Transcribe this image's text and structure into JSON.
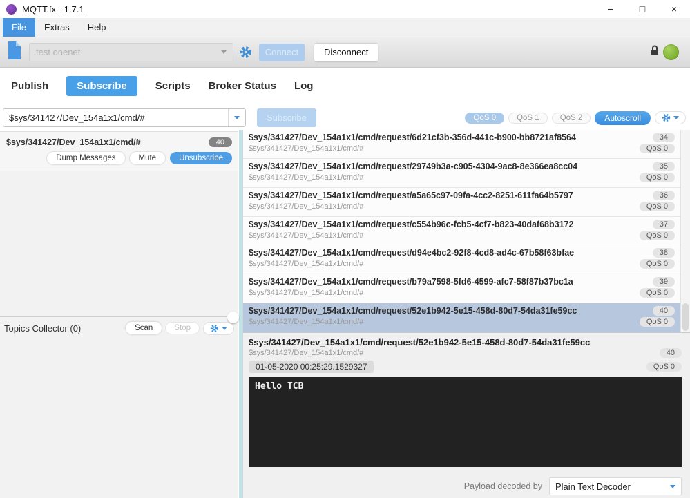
{
  "window": {
    "title": "MQTT.fx - 1.7.1",
    "controls": {
      "minimize": "−",
      "maximize": "□",
      "close": "×"
    }
  },
  "menu": {
    "items": [
      "File",
      "Extras",
      "Help"
    ]
  },
  "connection": {
    "profile_value": "test onenet",
    "connect_label": "Connect",
    "disconnect_label": "Disconnect"
  },
  "tabs": {
    "items": [
      "Publish",
      "Subscribe",
      "Scripts",
      "Broker Status",
      "Log"
    ],
    "active": "Subscribe"
  },
  "subscribe_bar": {
    "topic_value": "$sys/341427/Dev_154a1x1/cmd/#",
    "subscribe_label": "Subscribe",
    "qos_options": [
      "QoS 0",
      "QoS 1",
      "QoS 2"
    ],
    "qos_selected": "QoS 0",
    "autoscroll_label": "Autoscroll"
  },
  "subscription": {
    "topic": "$sys/341427/Dev_154a1x1/cmd/#",
    "count": "40",
    "dump_label": "Dump Messages",
    "mute_label": "Mute",
    "unsubscribe_label": "Unsubscribe"
  },
  "topics_collector": {
    "title": "Topics Collector (0)",
    "scan_label": "Scan",
    "stop_label": "Stop"
  },
  "messages": {
    "rows": [
      {
        "topic": "$sys/341427/Dev_154a1x1/cmd/request/6d21cf3b-356d-441c-b900-bb8721af8564",
        "subscription": "$sys/341427/Dev_154a1x1/cmd/#",
        "id": "34",
        "qos": "QoS 0",
        "selected": false
      },
      {
        "topic": "$sys/341427/Dev_154a1x1/cmd/request/29749b3a-c905-4304-9ac8-8e366ea8cc04",
        "subscription": "$sys/341427/Dev_154a1x1/cmd/#",
        "id": "35",
        "qos": "QoS 0",
        "selected": false
      },
      {
        "topic": "$sys/341427/Dev_154a1x1/cmd/request/a5a65c97-09fa-4cc2-8251-611fa64b5797",
        "subscription": "$sys/341427/Dev_154a1x1/cmd/#",
        "id": "36",
        "qos": "QoS 0",
        "selected": false
      },
      {
        "topic": "$sys/341427/Dev_154a1x1/cmd/request/c554b96c-fcb5-4cf7-b823-40daf68b3172",
        "subscription": "$sys/341427/Dev_154a1x1/cmd/#",
        "id": "37",
        "qos": "QoS 0",
        "selected": false
      },
      {
        "topic": "$sys/341427/Dev_154a1x1/cmd/request/d94e4bc2-92f8-4cd8-ad4c-67b58f63bfae",
        "subscription": "$sys/341427/Dev_154a1x1/cmd/#",
        "id": "38",
        "qos": "QoS 0",
        "selected": false
      },
      {
        "topic": "$sys/341427/Dev_154a1x1/cmd/request/b79a7598-5fd6-4599-afc7-58f87b37bc1a",
        "subscription": "$sys/341427/Dev_154a1x1/cmd/#",
        "id": "39",
        "qos": "QoS 0",
        "selected": false
      },
      {
        "topic": "$sys/341427/Dev_154a1x1/cmd/request/52e1b942-5e15-458d-80d7-54da31fe59cc",
        "subscription": "$sys/341427/Dev_154a1x1/cmd/#",
        "id": "40",
        "qos": "QoS 0",
        "selected": true
      }
    ]
  },
  "detail": {
    "topic": "$sys/341427/Dev_154a1x1/cmd/request/52e1b942-5e15-458d-80d7-54da31fe59cc",
    "subscription": "$sys/341427/Dev_154a1x1/cmd/#",
    "id": "40",
    "qos": "QoS 0",
    "timestamp": "01-05-2020  00:25:29.1529327",
    "payload": "Hello TCB",
    "decoder_label": "Payload decoded by",
    "decoder_value": "Plain Text Decoder"
  },
  "colors": {
    "accent_blue": "#4795e0",
    "selected_row": "#b7c7dd",
    "status_green": "#6aa122",
    "payload_bg": "#222222",
    "divider_teal": "#c0e3e7"
  }
}
